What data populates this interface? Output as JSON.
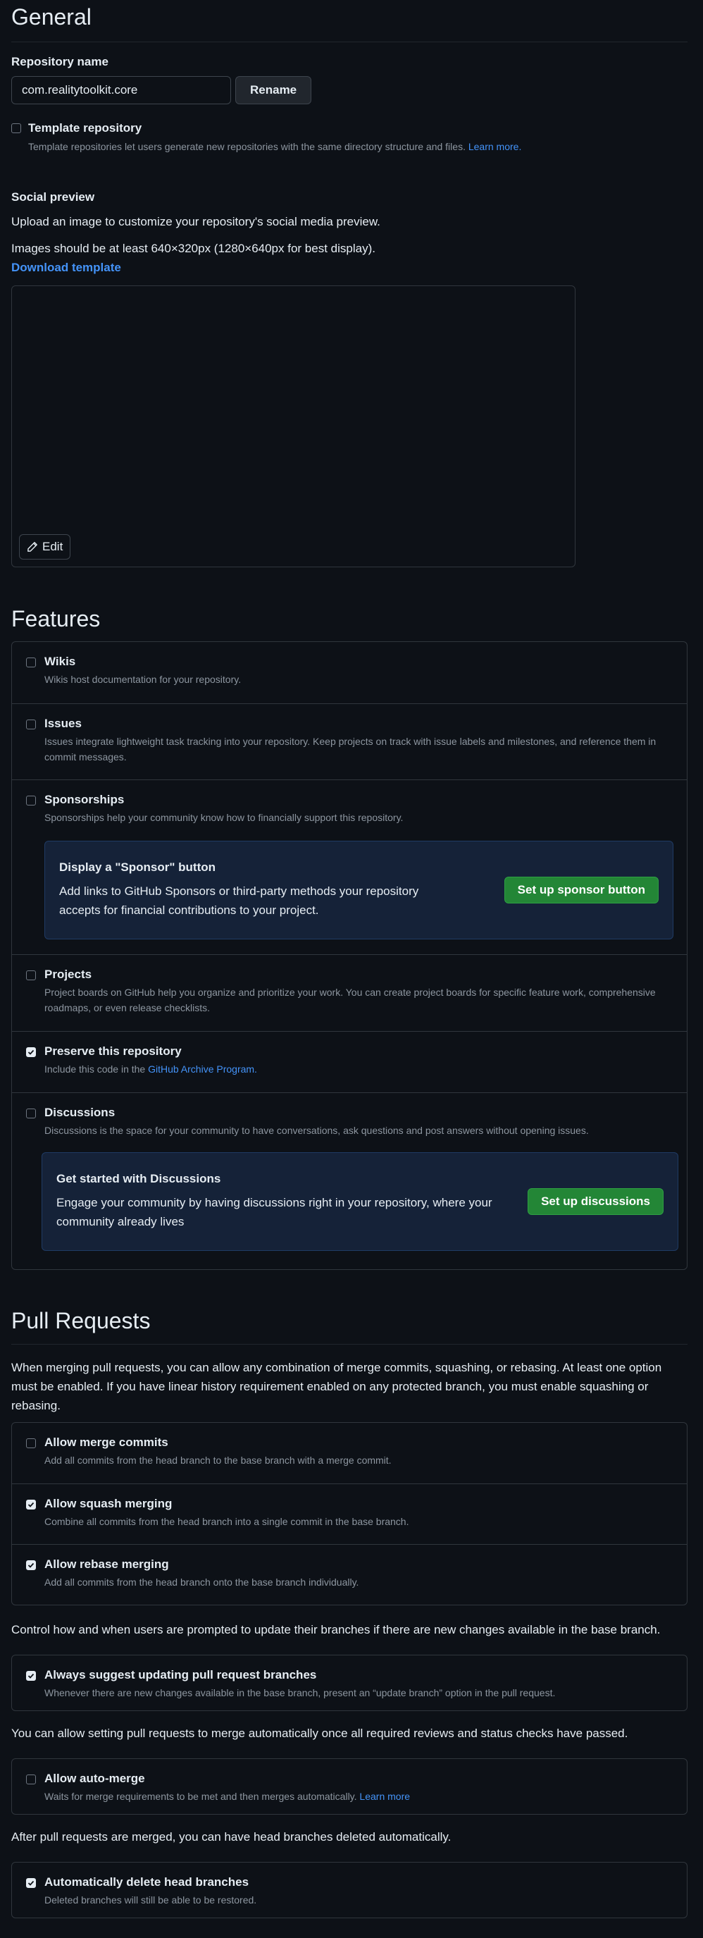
{
  "general": {
    "title": "General",
    "repo_name_label": "Repository name",
    "repo_name_value": "com.realitytoolkit.core",
    "rename_button": "Rename",
    "template_label": "Template repository",
    "template_desc": "Template repositories let users generate new repositories with the same directory structure and files.",
    "template_learn_more": "Learn more.",
    "template_checked": false
  },
  "social": {
    "title": "Social preview",
    "line1": "Upload an image to customize your repository's social media preview.",
    "line2": "Images should be at least 640×320px (1280×640px for best display).",
    "download_link": "Download template",
    "edit_button": "Edit"
  },
  "features": {
    "title": "Features",
    "wikis": {
      "label": "Wikis",
      "desc": "Wikis host documentation for your repository.",
      "checked": false
    },
    "issues": {
      "label": "Issues",
      "desc": "Issues integrate lightweight task tracking into your repository. Keep projects on track with issue labels and milestones, and reference them in commit messages.",
      "checked": false
    },
    "sponsorships": {
      "label": "Sponsorships",
      "desc": "Sponsorships help your community know how to financially support this repository.",
      "checked": false
    },
    "sponsor_callout": {
      "title": "Display a \"Sponsor\" button",
      "desc": "Add links to GitHub Sponsors or third-party methods your repository accepts for financial contributions to your project.",
      "button": "Set up sponsor button"
    },
    "projects": {
      "label": "Projects",
      "desc": "Project boards on GitHub help you organize and prioritize your work. You can create project boards for specific feature work, comprehensive roadmaps, or even release checklists.",
      "checked": false
    },
    "preserve": {
      "label": "Preserve this repository",
      "desc_prefix": "Include this code in the",
      "desc_link": "GitHub Archive Program.",
      "checked": true
    },
    "discussions": {
      "label": "Discussions",
      "desc": "Discussions is the space for your community to have conversations, ask questions and post answers without opening issues.",
      "checked": false
    },
    "discussions_callout": {
      "title": "Get started with Discussions",
      "desc": "Engage your community by having discussions right in your repository, where your community already lives",
      "button": "Set up discussions"
    }
  },
  "pull_requests": {
    "title": "Pull Requests",
    "intro": "When merging pull requests, you can allow any combination of merge commits, squashing, or rebasing. At least one option must be enabled. If you have linear history requirement enabled on any protected branch, you must enable squashing or rebasing.",
    "merge_commits": {
      "label": "Allow merge commits",
      "desc": "Add all commits from the head branch to the base branch with a merge commit.",
      "checked": false
    },
    "squash": {
      "label": "Allow squash merging",
      "desc": "Combine all commits from the head branch into a single commit in the base branch.",
      "checked": true
    },
    "rebase": {
      "label": "Allow rebase merging",
      "desc": "Add all commits from the head branch onto the base branch individually.",
      "checked": true
    },
    "update_intro": "Control how and when users are prompted to update their branches if there are new changes available in the base branch.",
    "suggest_update": {
      "label": "Always suggest updating pull request branches",
      "desc": "Whenever there are new changes available in the base branch, present an “update branch” option in the pull request.",
      "checked": true
    },
    "auto_merge_intro": "You can allow setting pull requests to merge automatically once all required reviews and status checks have passed.",
    "auto_merge": {
      "label": "Allow auto-merge",
      "desc": "Waits for merge requirements to be met and then merges automatically.",
      "link": "Learn more",
      "checked": false
    },
    "delete_intro": "After pull requests are merged, you can have head branches deleted automatically.",
    "delete_branches": {
      "label": "Automatically delete head branches",
      "desc": "Deleted branches will still be able to be restored.",
      "checked": true
    }
  }
}
